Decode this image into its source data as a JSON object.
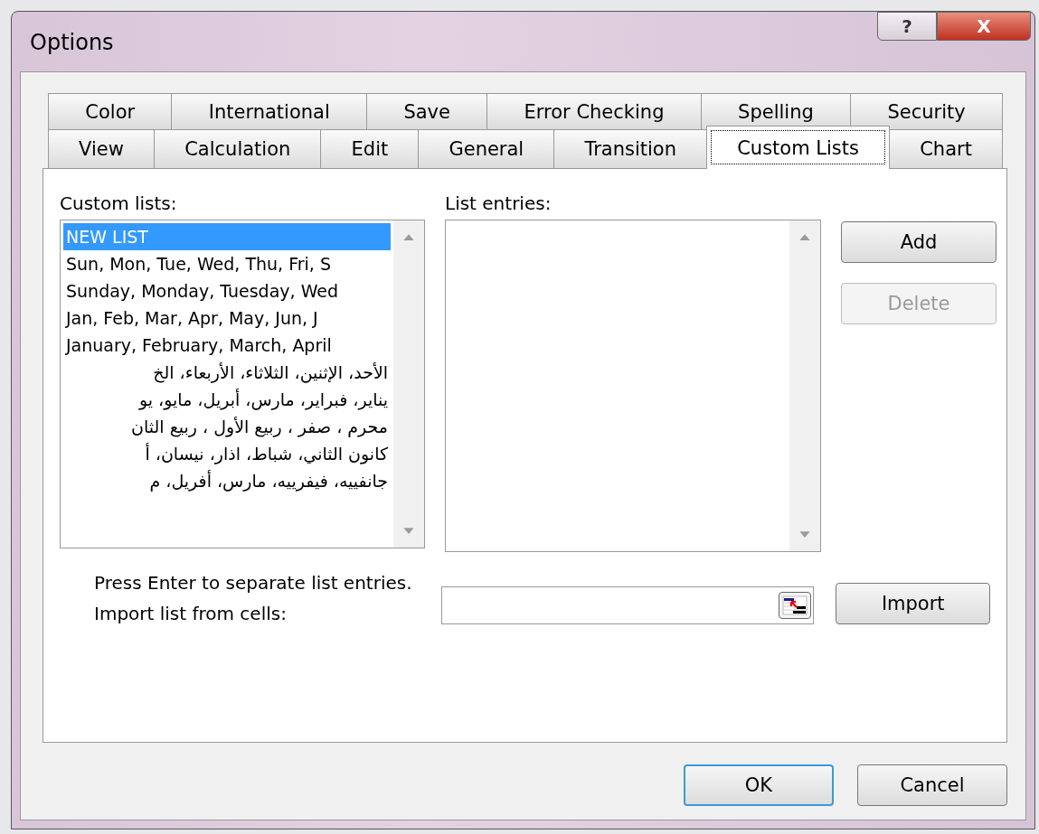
{
  "window": {
    "title": "Options",
    "title_buttons": [
      {
        "kind": "help",
        "label": "?"
      },
      {
        "kind": "close",
        "label": "X"
      }
    ]
  },
  "tab_rows": [
    [
      {
        "label": "Color",
        "selected": false
      },
      {
        "label": "International",
        "selected": false
      },
      {
        "label": "Save",
        "selected": false
      },
      {
        "label": "Error Checking",
        "selected": false
      },
      {
        "label": "Spelling",
        "selected": false
      },
      {
        "label": "Security",
        "selected": false
      }
    ],
    [
      {
        "label": "View",
        "selected": false
      },
      {
        "label": "Calculation",
        "selected": false
      },
      {
        "label": "Edit",
        "selected": false
      },
      {
        "label": "General",
        "selected": false
      },
      {
        "label": "Transition",
        "selected": false
      },
      {
        "label": "Custom Lists",
        "selected": true
      },
      {
        "label": "Chart",
        "selected": false
      }
    ]
  ],
  "custom_lists": {
    "label": "Custom lists:",
    "items": [
      {
        "text": "NEW LIST",
        "selected": true
      },
      {
        "text": "Sun, Mon, Tue, Wed, Thu, Fri, S",
        "selected": false
      },
      {
        "text": "Sunday, Monday, Tuesday, Wed",
        "selected": false
      },
      {
        "text": "Jan, Feb, Mar, Apr, May, Jun, J",
        "selected": false
      },
      {
        "text": "January, February, March, April",
        "selected": false
      },
      {
        "text": "الأحد، الإثنين، الثلاثاء، الأربعاء، الخ",
        "selected": false
      },
      {
        "text": "يناير، فبراير، مارس، أبريل، مايو، يو",
        "selected": false
      },
      {
        "text": "محرم ، صفر ، ربيع الأول ، ربيع الثان",
        "selected": false
      },
      {
        "text": "كانون الثاني، شباط، اذار، نيسان، أ",
        "selected": false
      },
      {
        "text": "جانفييه، فيفرييه، مارس، أفريل، م",
        "selected": false
      }
    ]
  },
  "list_entries": {
    "label": "List entries:"
  },
  "side_buttons": [
    {
      "label": "Add",
      "disabled": false
    },
    {
      "label": "Delete",
      "disabled": true
    }
  ],
  "hint": "Press Enter to separate list entries.",
  "import": {
    "label": "Import list from cells:",
    "button": "Import"
  },
  "footer_buttons": [
    {
      "label": "OK",
      "default": true
    },
    {
      "label": "Cancel",
      "default": false
    }
  ]
}
